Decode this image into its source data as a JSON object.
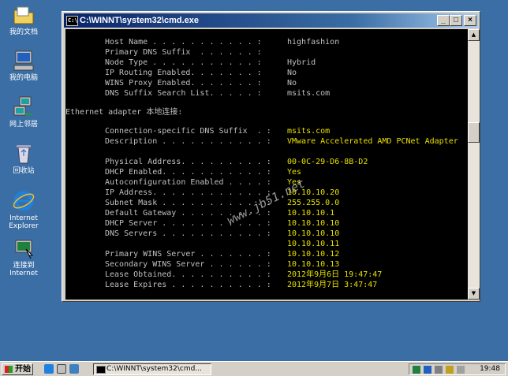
{
  "desktop": {
    "icons": [
      {
        "label": "我的文档"
      },
      {
        "label": "我的电脑"
      },
      {
        "label": "网上邻居"
      },
      {
        "label": "回收站"
      },
      {
        "label": "Internet Explorer"
      },
      {
        "label": "连接到 Internet"
      }
    ]
  },
  "window": {
    "title": "C:\\WINNT\\system32\\cmd.exe",
    "console": {
      "top_lines": [
        {
          "label": "Host Name . . . . . . . . . . . :",
          "value": "highfashion"
        },
        {
          "label": "Primary DNS Suffix  . . . . . . :",
          "value": ""
        },
        {
          "label": "Node Type . . . . . . . . . . . :",
          "value": "Hybrid"
        },
        {
          "label": "IP Routing Enabled. . . . . . . :",
          "value": "No"
        },
        {
          "label": "WINS Proxy Enabled. . . . . . . :",
          "value": "No"
        },
        {
          "label": "DNS Suffix Search List. . . . . :",
          "value": "msits.com"
        }
      ],
      "adapter_heading": "Ethernet adapter 本地连接:",
      "adapter_lines": [
        {
          "label": "Connection-specific DNS Suffix  . :",
          "value": "msits.com"
        },
        {
          "label": "Description . . . . . . . . . . . :",
          "value": "VMware Accelerated AMD PCNet Adapter"
        },
        {
          "label": "",
          "value": ""
        },
        {
          "label": "Physical Address. . . . . . . . . :",
          "value": "00-0C-29-D6-8B-D2"
        },
        {
          "label": "DHCP Enabled. . . . . . . . . . . :",
          "value": "Yes"
        },
        {
          "label": "Autoconfiguration Enabled . . . . :",
          "value": "Yes"
        },
        {
          "label": "IP Address. . . . . . . . . . . . :",
          "value": "10.10.10.20"
        },
        {
          "label": "Subnet Mask . . . . . . . . . . . :",
          "value": "255.255.0.0"
        },
        {
          "label": "Default Gateway . . . . . . . . . :",
          "value": "10.10.10.1"
        },
        {
          "label": "DHCP Server . . . . . . . . . . . :",
          "value": "10.10.10.10"
        },
        {
          "label": "DNS Servers . . . . . . . . . . . :",
          "value": "10.10.10.10"
        },
        {
          "label": "",
          "value": "10.10.10.11"
        },
        {
          "label": "Primary WINS Server . . . . . . . :",
          "value": "10.10.10.12"
        },
        {
          "label": "Secondary WINS Server . . . . . . :",
          "value": "10.10.10.13"
        },
        {
          "label": "Lease Obtained. . . . . . . . . . :",
          "value": "2012年9月6日 19:47:47"
        },
        {
          "label": "Lease Expires . . . . . . . . . . :",
          "value": "2012年9月7日 3:47:47"
        }
      ]
    },
    "watermark": "www.jb51.net"
  },
  "taskbar": {
    "start_label": "开始",
    "task_label": "C:\\WINNT\\system32\\cmd...",
    "clock": "19:48"
  },
  "colors": {
    "desktop": "#3a6ea5",
    "console_text": "#c0c0c0",
    "highlight_text": "#e8e000"
  }
}
